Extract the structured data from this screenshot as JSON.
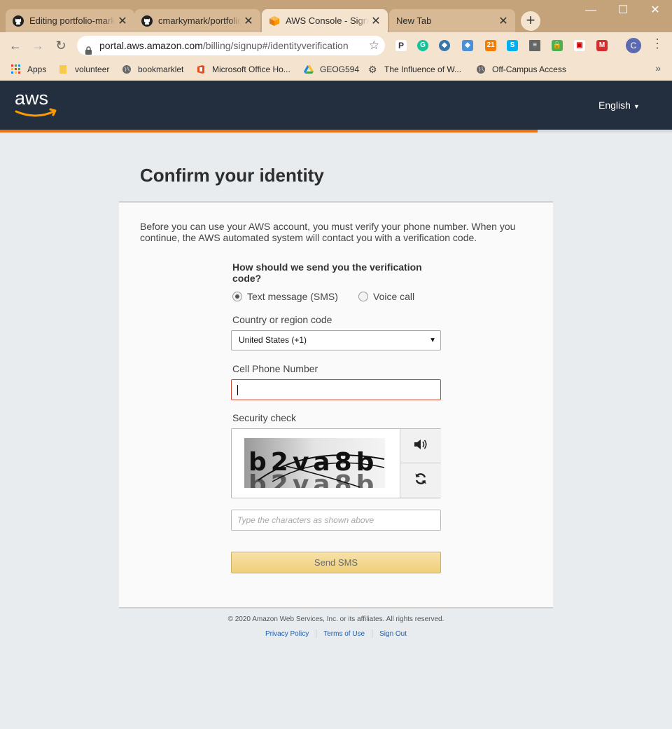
{
  "browser": {
    "tabs": [
      {
        "title": "Editing portfolio-mark",
        "icon": "github-icon",
        "active": false
      },
      {
        "title": "cmarkymark/portfolio",
        "icon": "github-icon",
        "active": false
      },
      {
        "title": "AWS Console - Signup",
        "icon": "aws-cube-icon",
        "active": true
      },
      {
        "title": "New Tab",
        "icon": "",
        "active": false
      }
    ],
    "url_host": "portal.aws.amazon.com",
    "url_path": "/billing/signup#/identityverification",
    "profile_initial": "C",
    "extension_badge": "21",
    "bookmarks": [
      {
        "label": "Apps",
        "icon": "apps-grid-icon"
      },
      {
        "label": "volunteer",
        "icon": "folder-icon"
      },
      {
        "label": "bookmarklet",
        "icon": "globe-icon"
      },
      {
        "label": "Microsoft Office Ho...",
        "icon": "office-icon"
      },
      {
        "label": "GEOG594",
        "icon": "drive-icon"
      },
      {
        "label": "The Influence of W...",
        "icon": "gear-icon"
      },
      {
        "label": "Off-Campus Access",
        "icon": "globe-icon"
      }
    ],
    "bookmarks_overflow": "»"
  },
  "aws": {
    "logo_text": "aws",
    "language": "English",
    "signup_progress": 0.8
  },
  "page": {
    "title": "Confirm your identity",
    "intro": "Before you can use your AWS account, you must verify your phone number. When you continue, the AWS automated system will contact you with a verification code.",
    "question": "How should we send you the verification code?",
    "method_options": [
      {
        "label": "Text message (SMS)",
        "selected": true
      },
      {
        "label": "Voice call",
        "selected": false
      }
    ],
    "country_label": "Country or region code",
    "country_value": "United States (+1)",
    "phone_label": "Cell Phone Number",
    "phone_value": "",
    "security_label": "Security check",
    "captcha_text": "b2va8b",
    "captcha_placeholder": "Type the characters as shown above",
    "submit_label": "Send SMS"
  },
  "footer": {
    "copyright": "© 2020 Amazon Web Services, Inc. or its affiliates. All rights reserved.",
    "links": [
      "Privacy Policy",
      "Terms of Use",
      "Sign Out"
    ]
  },
  "colors": {
    "aws_header": "#232f3e",
    "aws_orange": "#ec7211",
    "error_border": "#d34b37",
    "button_yellow": "#f0cf7a",
    "link_blue": "#1a5fb4"
  }
}
